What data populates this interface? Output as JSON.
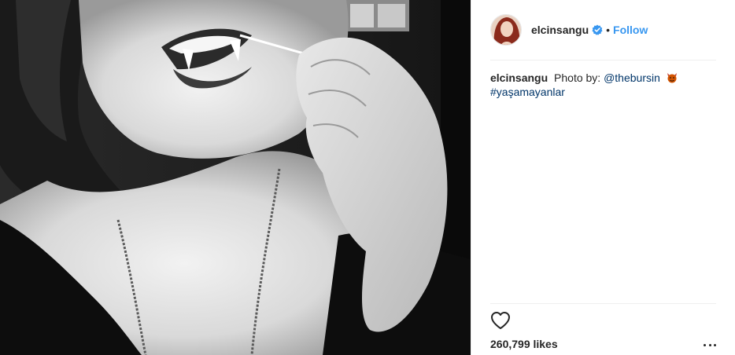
{
  "post": {
    "username": "elcinsangu",
    "follow_label": "Follow",
    "separator": "•",
    "caption": {
      "username": "elcinsangu",
      "text_prefix": "Photo by:",
      "mention": "@thebursin",
      "hashtag": "#yaşamayanlar"
    },
    "likes": "260,799 likes",
    "icons": {
      "verified": "verified-badge-icon",
      "like": "heart-outline-icon",
      "more": "more-options-icon",
      "emoji": "devil-face-emoji-icon"
    },
    "colors": {
      "follow": "#3897f0",
      "link": "#003569",
      "text": "#262626",
      "divider": "#efefef"
    }
  }
}
